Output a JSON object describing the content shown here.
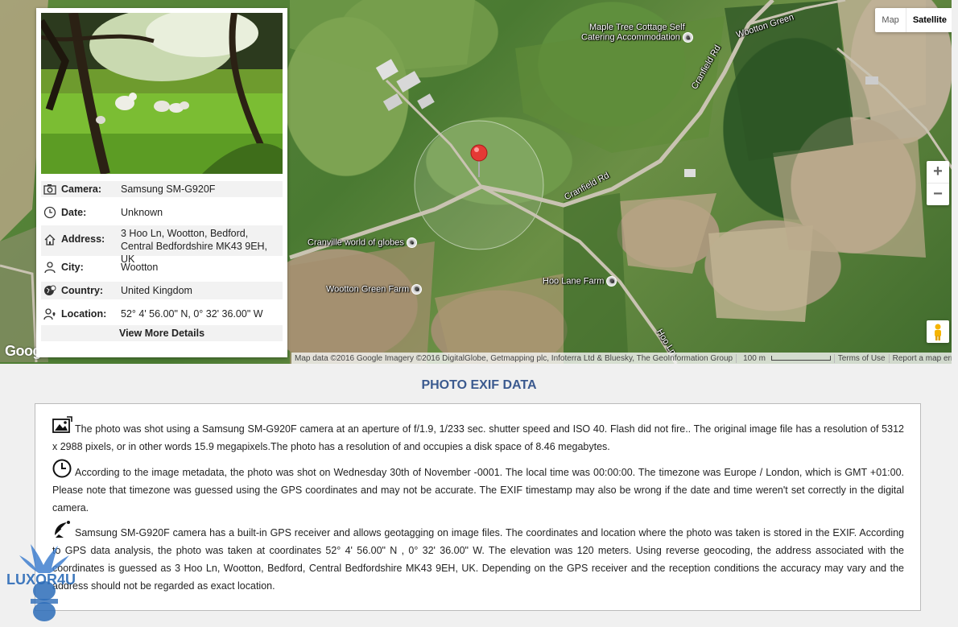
{
  "map": {
    "type_buttons": [
      "Map",
      "Satellite"
    ],
    "active_type": "Satellite",
    "zoom_in": "+",
    "zoom_out": "−",
    "labels": {
      "maple_tree": "Maple Tree Cottage Self",
      "maple_tree_2": "Catering Accommodation",
      "wootton_green": "Wootton Green",
      "cranfield_rd_1": "Cranfield Rd",
      "cranfield_rd_2": "Cranfield Rd",
      "cranville": "Cranville world of globes",
      "wootton_green_farm": "Wootton Green Farm",
      "hoo_lane_farm": "Hoo Lane Farm",
      "hoo_ln": "Hoo Ln"
    },
    "attribution": "Map data ©2016 Google Imagery ©2016 DigitalGlobe, Getmapping plc, Infoterra Ltd & Bluesky, The GeoInformation Group",
    "scale": "100 m",
    "terms": "Terms of Use",
    "report": "Report a map error",
    "logo": "Google"
  },
  "card": {
    "camera_label": "Camera:",
    "camera": "Samsung SM-G920F",
    "date_label": "Date:",
    "date": "Unknown",
    "address_label": "Address:",
    "address": "3 Hoo Ln, Wootton, Bedford, Central Bedfordshire MK43 9EH, UK",
    "city_label": "City:",
    "city": "Wootton",
    "country_label": "Country:",
    "country": "United Kingdom",
    "location_label": "Location:",
    "location": "52° 4' 56.00\" N, 0° 32' 36.00\" W",
    "more": "View More Details"
  },
  "exif": {
    "title": "PHOTO EXIF DATA",
    "p1": "The photo was shot using a Samsung SM-G920F camera at an aperture of f/1.9, 1/233 sec. shutter speed and ISO 40. Flash did not fire.. The original image file has a resolution of 5312 x 2988 pixels, or in other words 15.9 megapixels.The photo has a resolution of and occupies a disk space of 8.46 megabytes.",
    "p2": "According to the image metadata, the photo was shot on Wednesday 30th of November -0001. The local time was 00:00:00. The timezone was Europe / London, which is GMT +01:00. Please note that timezone was guessed using the GPS coordinates and may not be accurate. The EXIF timestamp may also be wrong if the date and time weren't set correctly in the digital camera.",
    "p3": "Samsung SM-G920F camera has a built-in GPS receiver and allows geotagging on image files. The coordinates and location where the photo was taken is stored in the EXIF. According to GPS data analysis, the photo was taken at coordinates 52° 4' 56.00\" N , 0° 32' 36.00\" W. The elevation was 120 meters. Using reverse geocoding, the address associated with the coordinates is guessed as 3 Hoo Ln, Wootton, Bedford, Central Bedfordshire MK43 9EH, UK. Depending on the GPS receiver and the reception conditions the accuracy may vary and the address should not be regarded as exact location."
  },
  "watermark": "LUXOR4U"
}
